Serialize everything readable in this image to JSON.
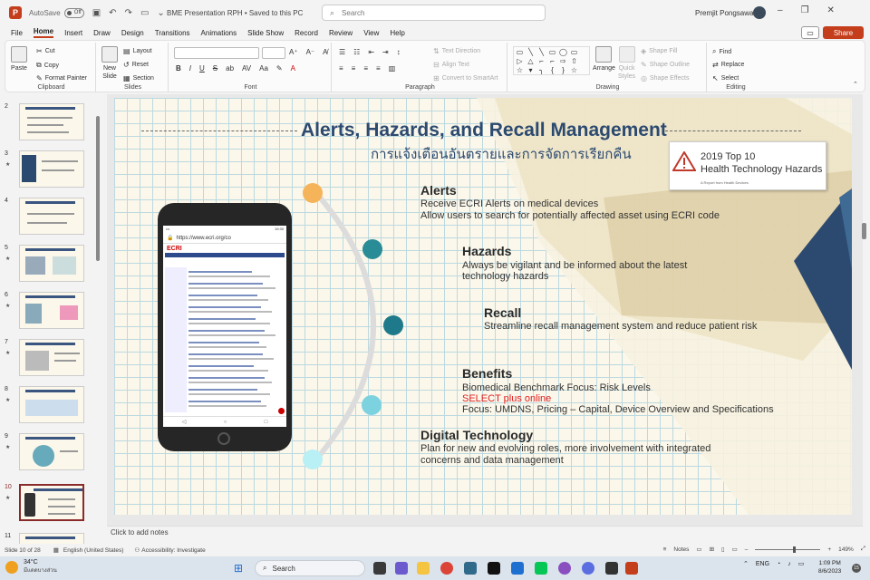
{
  "titlebar": {
    "logo_letter": "P",
    "autosave_label": "AutoSave",
    "autosave_state": "Off",
    "doc_title": "BME Presentation RPH • Saved to this PC",
    "search_placeholder": "Search",
    "user_name": "Premjit Pongsawan"
  },
  "menu": {
    "items": [
      "File",
      "Home",
      "Insert",
      "Draw",
      "Design",
      "Transitions",
      "Animations",
      "Slide Show",
      "Record",
      "Review",
      "View",
      "Help"
    ],
    "active": "Home",
    "share_label": "Share"
  },
  "ribbon": {
    "clipboard": {
      "label": "Clipboard",
      "paste": "Paste",
      "cut": "Cut",
      "copy": "Copy",
      "format_painter": "Format Painter"
    },
    "slides": {
      "label": "Slides",
      "new_slide_1": "New",
      "new_slide_2": "Slide",
      "layout": "Layout",
      "reset": "Reset",
      "section": "Section"
    },
    "font": {
      "label": "Font"
    },
    "paragraph": {
      "label": "Paragraph",
      "text_direction": "Text Direction",
      "align_text": "Align Text",
      "convert_smartart": "Convert to SmartArt"
    },
    "drawing": {
      "label": "Drawing",
      "arrange": "Arrange",
      "quick_styles_1": "Quick",
      "quick_styles_2": "Styles",
      "shape_fill": "Shape Fill",
      "shape_outline": "Shape Outline",
      "shape_effects": "Shape Effects"
    },
    "editing": {
      "label": "Editing",
      "find": "Find",
      "replace": "Replace",
      "select": "Select"
    }
  },
  "thumbnails": [
    "2",
    "3",
    "4",
    "5",
    "6",
    "7",
    "8",
    "9",
    "10",
    "11"
  ],
  "active_slide": "10",
  "slide": {
    "title": "Alerts, Hazards, and Recall Management",
    "subtitle": "การแจ้งเตือนอันตรายและการจัดการเรียกคืน",
    "ecri": {
      "line1": "2019 Top 10",
      "line2": "Health Technology Hazards",
      "line3": "A Report from Health Devices"
    },
    "phone": {
      "time": "19:30",
      "url": "https://www.ecri.org/co",
      "logo": "ECRI"
    },
    "sections": {
      "alerts": {
        "heading": "Alerts",
        "line1": "Receive ECRI Alerts on medical devices",
        "line2": "Allow users to search for potentially affected asset using ECRI code"
      },
      "hazards": {
        "heading": "Hazards",
        "line1": "Always be vigilant and be informed about the latest",
        "line2": "technology hazards"
      },
      "recall": {
        "heading": "Recall",
        "line1": "Streamline recall management system and reduce patient risk"
      },
      "benefits": {
        "heading": "Benefits",
        "line1": "Biomedical Benchmark Focus: Risk Levels",
        "line2": "SELECT plus online",
        "line3": "Focus: UMDNS, Pricing – Capital, Device Overview and Specifications"
      },
      "digital": {
        "heading": "Digital Technology",
        "line1": "Plan for new and evolving roles, more involvement with integrated",
        "line2": "concerns and data management"
      }
    },
    "dot_colors": [
      "#f5b45a",
      "#2a8c96",
      "#1e7a8a",
      "#7dd2e0",
      "#b8f0f5"
    ]
  },
  "notes_placeholder": "Click to add notes",
  "status": {
    "slide_counter": "Slide 10 of 28",
    "language": "English (United States)",
    "accessibility": "Accessibility: Investigate",
    "notes": "Notes",
    "zoom": "149%"
  },
  "taskbar": {
    "temp": "34°C",
    "weather": "มีแดดบางส่วน",
    "search": "Search",
    "lang": "ENG",
    "time": "1:09 PM",
    "date": "8/6/2023",
    "notif_count": "15"
  }
}
